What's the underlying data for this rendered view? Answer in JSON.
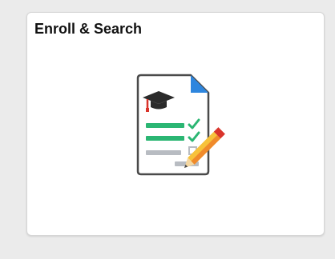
{
  "tile": {
    "title": "Enroll & Search",
    "icon": "enrollment-document-pencil-icon"
  },
  "colors": {
    "page_background": "#ebebeb",
    "tile_background": "#ffffff",
    "document_border": "#4a4a4a",
    "fold_blue": "#2e86de",
    "mortarboard": "#2b2b2b",
    "tassel_red": "#d9342b",
    "list_green": "#2bb673",
    "list_gray": "#b8bcc2",
    "pencil_yellow": "#f7c23b",
    "pencil_orange": "#f08a2b"
  }
}
